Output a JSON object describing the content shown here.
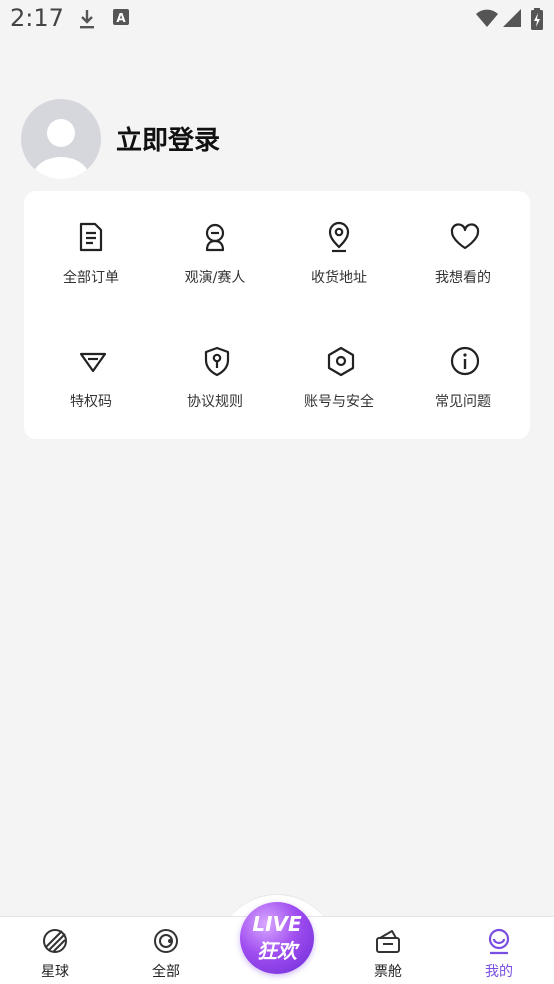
{
  "status_bar": {
    "time": "2:17"
  },
  "profile": {
    "login_label": "立即登录"
  },
  "menu": {
    "items": [
      {
        "label": "全部订单",
        "icon": "document-icon"
      },
      {
        "label": "观演/赛人",
        "icon": "person-badge-icon"
      },
      {
        "label": "收货地址",
        "icon": "location-pin-icon"
      },
      {
        "label": "我想看的",
        "icon": "heart-icon"
      },
      {
        "label": "特权码",
        "icon": "diamond-icon"
      },
      {
        "label": "协议规则",
        "icon": "shield-key-icon"
      },
      {
        "label": "账号与安全",
        "icon": "hexagon-nut-icon"
      },
      {
        "label": "常见问题",
        "icon": "info-icon"
      }
    ]
  },
  "tabbar": {
    "tabs": [
      {
        "label": "星球",
        "icon": "planet-icon"
      },
      {
        "label": "全部",
        "icon": "radar-icon"
      },
      {
        "label": "票舱",
        "icon": "ticket-box-icon"
      },
      {
        "label": "我的",
        "icon": "profile-icon",
        "active": true
      }
    ],
    "center": {
      "line1": "LIVE",
      "line2": "狂欢"
    },
    "active_color": "#7a4ee0"
  }
}
